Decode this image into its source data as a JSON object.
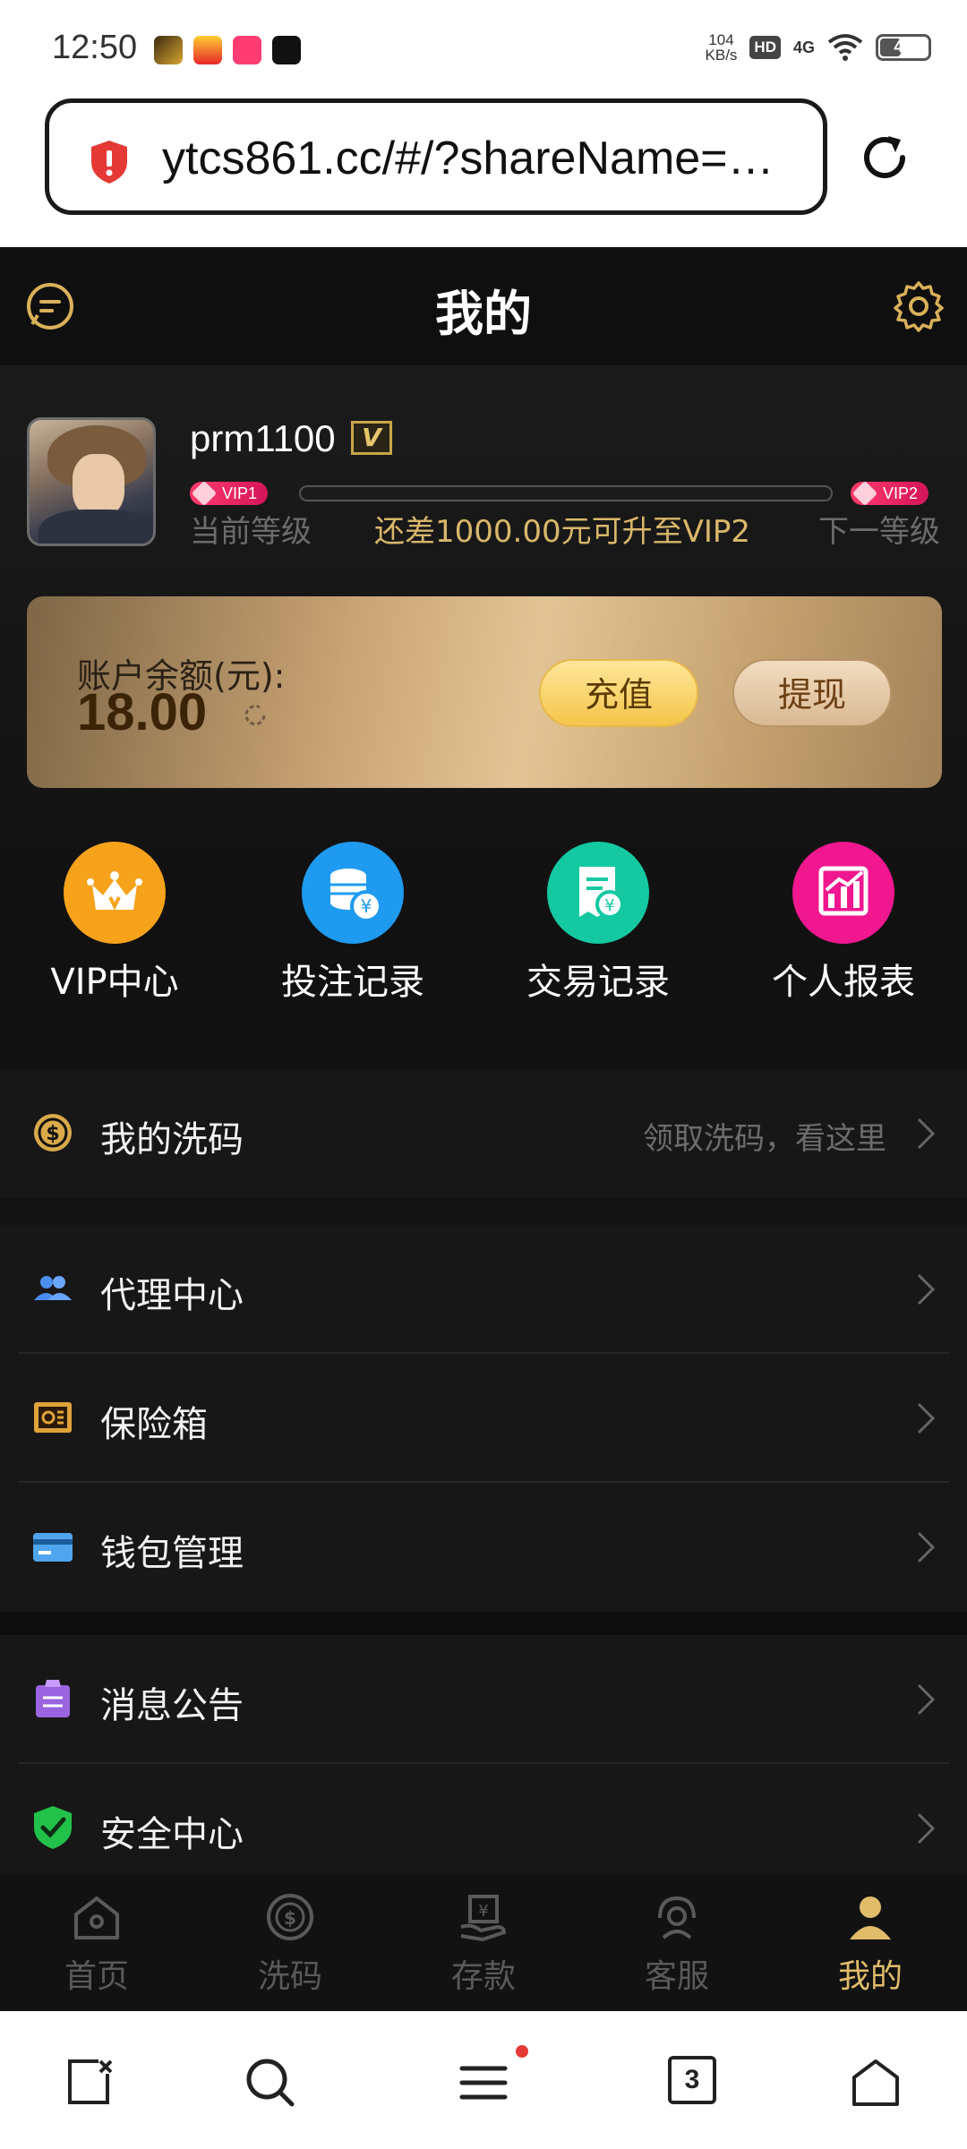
{
  "status_bar": {
    "time": "12:50",
    "speed_value": "104",
    "speed_unit": "KB/s",
    "hd": "HD",
    "network": "4G",
    "battery": "41",
    "battery_level": 0.41,
    "app_icons": [
      "game-app-icon",
      "news-app-icon",
      "kuaishou-app-icon",
      "tiktok-app-icon"
    ]
  },
  "browser": {
    "url": "ytcs861.cc/#/?shareName=…",
    "security_icon": "red-shield-icon",
    "reload_icon": "reload-icon"
  },
  "header": {
    "title": "我的",
    "left_icon": "chat-bubble-icon",
    "right_icon": "gear-icon"
  },
  "profile": {
    "username": "prm1100",
    "badge": "V",
    "current_vip": "VIP1",
    "next_vip": "VIP2",
    "progress": 0,
    "current_level_label": "当前等级",
    "upgrade_hint": "还差1000.00元可升至VIP2",
    "next_level_label": "下一等级"
  },
  "balance": {
    "label": "账户余额(元):",
    "value": "18.00",
    "charge_label": "充值",
    "withdraw_label": "提现"
  },
  "quick_actions": [
    {
      "label": "VIP中心",
      "icon": "crown-icon",
      "color": "#f7a21b"
    },
    {
      "label": "投注记录",
      "icon": "coins-icon",
      "color": "#1e9bf0"
    },
    {
      "label": "交易记录",
      "icon": "receipt-icon",
      "color": "#14c9a2"
    },
    {
      "label": "个人报表",
      "icon": "chart-icon",
      "color": "#f0178f"
    }
  ],
  "menu": {
    "wash": {
      "label": "我的洗码",
      "hint": "领取洗码，看这里"
    },
    "agent": {
      "label": "代理中心"
    },
    "safe": {
      "label": "保险箱"
    },
    "wallet": {
      "label": "钱包管理"
    },
    "notice": {
      "label": "消息公告"
    },
    "security": {
      "label": "安全中心"
    }
  },
  "tabs": [
    {
      "label": "首页",
      "icon": "home-icon"
    },
    {
      "label": "洗码",
      "icon": "dollar-circle-icon"
    },
    {
      "label": "存款",
      "icon": "deposit-icon"
    },
    {
      "label": "客服",
      "icon": "headset-icon"
    },
    {
      "label": "我的",
      "icon": "user-icon",
      "active": true
    }
  ],
  "system_nav": {
    "tab_count": "3"
  },
  "colors": {
    "gold": "#e1bc6a",
    "app_bg": "#0d0d0d",
    "vip_pink": "#ff3b6b"
  }
}
